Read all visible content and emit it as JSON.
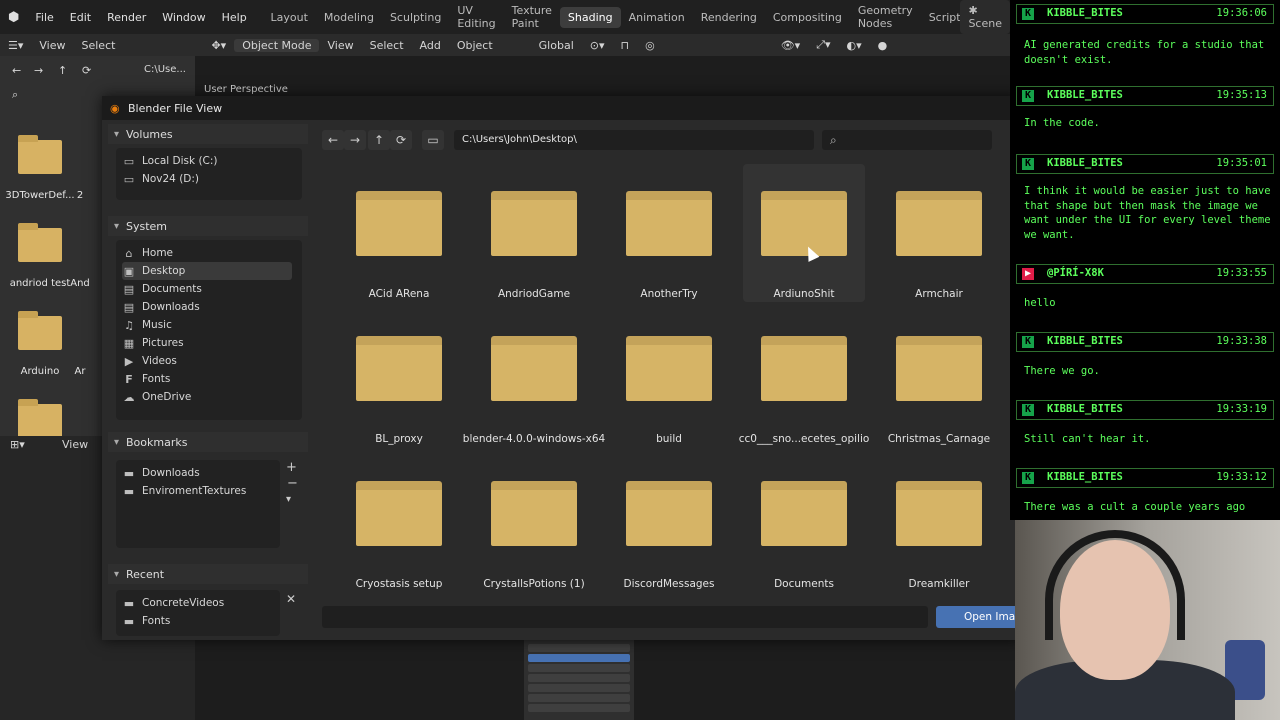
{
  "app": {
    "menus": [
      "File",
      "Edit",
      "Render",
      "Window",
      "Help"
    ],
    "workspaces": [
      "Layout",
      "Modeling",
      "Sculpting",
      "UV Editing",
      "Texture Paint",
      "Shading",
      "Animation",
      "Rendering",
      "Compositing",
      "Geometry Nodes",
      "Scripting"
    ],
    "active_workspace": "Shading",
    "scene_label": "Scene"
  },
  "toolbar": {
    "left_view": "View",
    "left_select": "Select",
    "mode": "Object Mode",
    "view": "View",
    "select": "Select",
    "add": "Add",
    "object": "Object",
    "transform": "Global",
    "viewport_label": "User Perspective",
    "lower_view": "View"
  },
  "background_browser": {
    "path": "C:\\Use...",
    "items": [
      "3DTowerDef...",
      "andriod test",
      "Arduino"
    ],
    "partial_items": [
      "2",
      "And",
      "Ar"
    ]
  },
  "dialog": {
    "title": "Blender File View",
    "path": "C:\\Users\\John\\Desktop\\",
    "open_button": "Open Image",
    "sections": {
      "volumes": {
        "title": "Volumes",
        "items": [
          {
            "label": "Local Disk (C:)",
            "icon": "drive-icon"
          },
          {
            "label": "Nov24 (D:)",
            "icon": "drive-icon"
          }
        ]
      },
      "system": {
        "title": "System",
        "items": [
          {
            "label": "Home",
            "icon": "home-icon"
          },
          {
            "label": "Desktop",
            "icon": "desktop-icon"
          },
          {
            "label": "Documents",
            "icon": "documents-icon"
          },
          {
            "label": "Downloads",
            "icon": "downloads-icon"
          },
          {
            "label": "Music",
            "icon": "music-icon"
          },
          {
            "label": "Pictures",
            "icon": "pictures-icon"
          },
          {
            "label": "Videos",
            "icon": "videos-icon"
          },
          {
            "label": "Fonts",
            "icon": "fonts-icon"
          },
          {
            "label": "OneDrive",
            "icon": "cloud-icon"
          }
        ],
        "active": "Desktop"
      },
      "bookmarks": {
        "title": "Bookmarks",
        "items": [
          {
            "label": "Downloads",
            "icon": "folder-icon"
          },
          {
            "label": "EnviromentTextures",
            "icon": "folder-icon"
          }
        ]
      },
      "recent": {
        "title": "Recent",
        "items": [
          {
            "label": "ConcreteVideos",
            "icon": "folder-icon"
          },
          {
            "label": "Fonts",
            "icon": "folder-icon"
          }
        ]
      }
    },
    "folders": [
      "ACid ARena",
      "AndriodGame",
      "AnotherTry",
      "ArdiunoShit",
      "Armchair",
      "BL_proxy",
      "blender-4.0.0-windows-x64",
      "build",
      "cc0___sno...ecetes_opilio",
      "Christmas_Carnage",
      "Cryostasis setup",
      "CrystallsPotions (1)",
      "DiscordMessages",
      "Documents",
      "Dreamkiller"
    ],
    "hovered_folder": "ArdiunoShit"
  },
  "chat": [
    {
      "user": "KIBBLE_BITES",
      "time": "19:36:06",
      "platform": "kick",
      "text": "AI generated credits for a studio that doesn't exist."
    },
    {
      "user": "KIBBLE_BITES",
      "time": "19:35:13",
      "platform": "kick",
      "text": "In the code."
    },
    {
      "user": "KIBBLE_BITES",
      "time": "19:35:01",
      "platform": "kick",
      "text": "I think it would be easier just to have that shape but then mask the image we want under the UI for every level theme we want."
    },
    {
      "user": "@PÍRÍ-X8K",
      "time": "19:33:55",
      "platform": "youtube",
      "text": "hello"
    },
    {
      "user": "KIBBLE_BITES",
      "time": "19:33:38",
      "platform": "kick",
      "text": "There we go."
    },
    {
      "user": "KIBBLE_BITES",
      "time": "19:33:19",
      "platform": "kick",
      "text": "Still can't hear it."
    },
    {
      "user": "KIBBLE_BITES",
      "time": "19:33:12",
      "platform": "kick",
      "text": "There was a cult a couple years ago"
    }
  ],
  "colors": {
    "accent": "#4772b3",
    "folder": "#d6b466",
    "chat_green": "#5cff5c"
  }
}
